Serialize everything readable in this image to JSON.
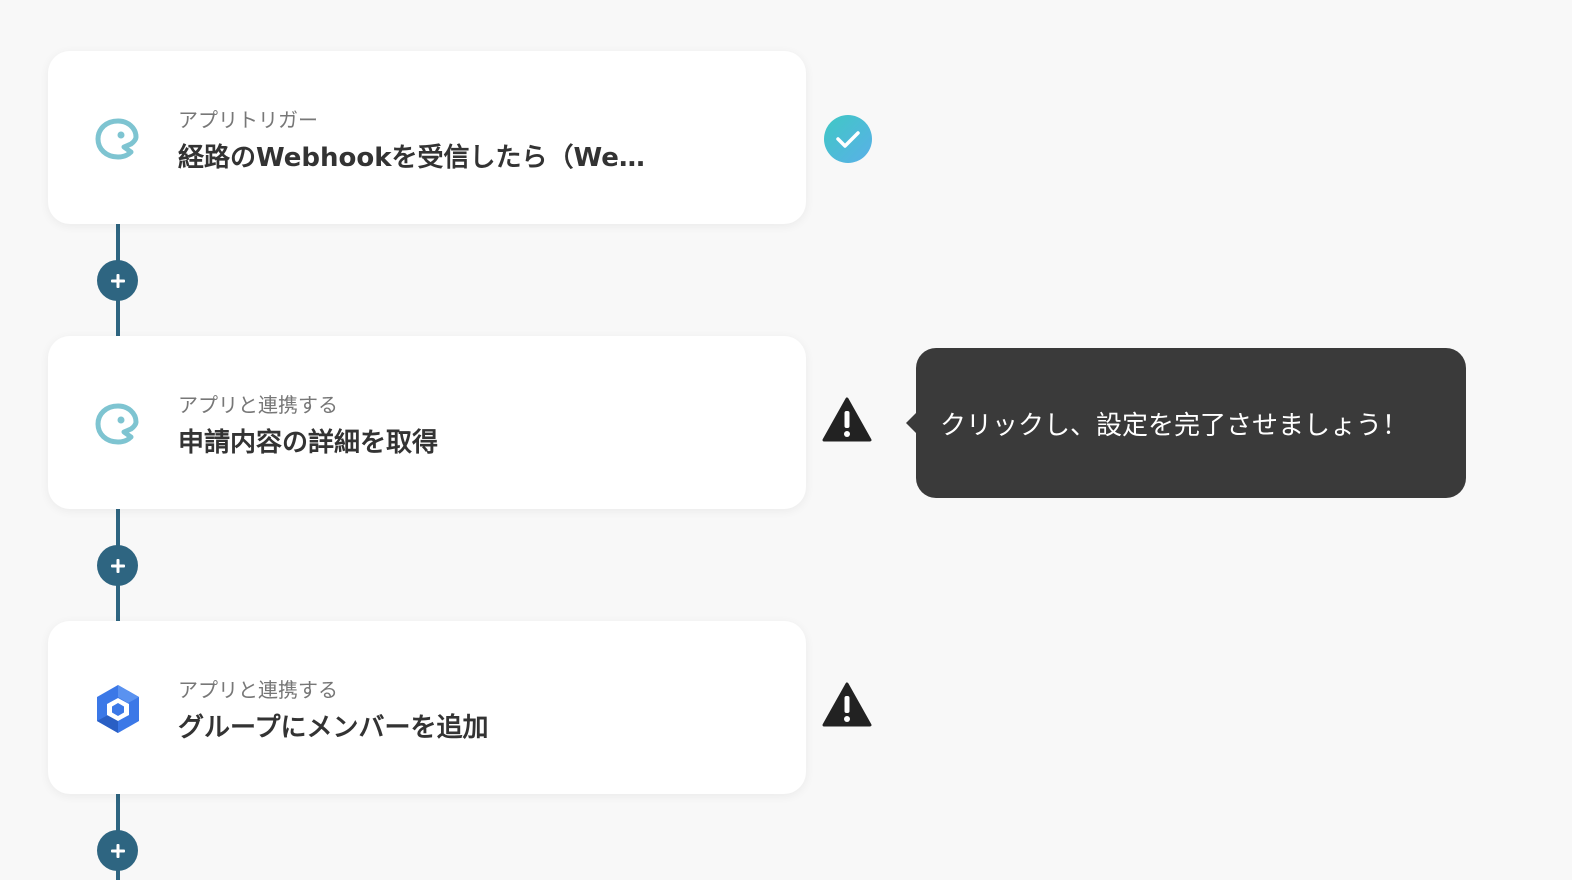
{
  "steps": [
    {
      "subtitle": "アプリトリガー",
      "title": "経路のWebhookを受信したら（We…",
      "app_icon": "webhook-bird-icon",
      "status": "complete"
    },
    {
      "subtitle": "アプリと連携する",
      "title": "申請内容の詳細を取得",
      "app_icon": "webhook-bird-icon",
      "status": "warning"
    },
    {
      "subtitle": "アプリと連携する",
      "title": "グループにメンバーを追加",
      "app_icon": "google-workspace-icon",
      "status": "warning"
    }
  ],
  "tooltip": {
    "text": "クリックし、設定を完了させましょう！"
  },
  "colors": {
    "background": "#f8f8f8",
    "connector": "#2e6581",
    "complete": "#4fbfd6",
    "warning": "#222222",
    "tooltip_bg": "#3a3a3a",
    "bird_icon": "#7ec4d1",
    "workspace_blue": "#3b78e7"
  }
}
